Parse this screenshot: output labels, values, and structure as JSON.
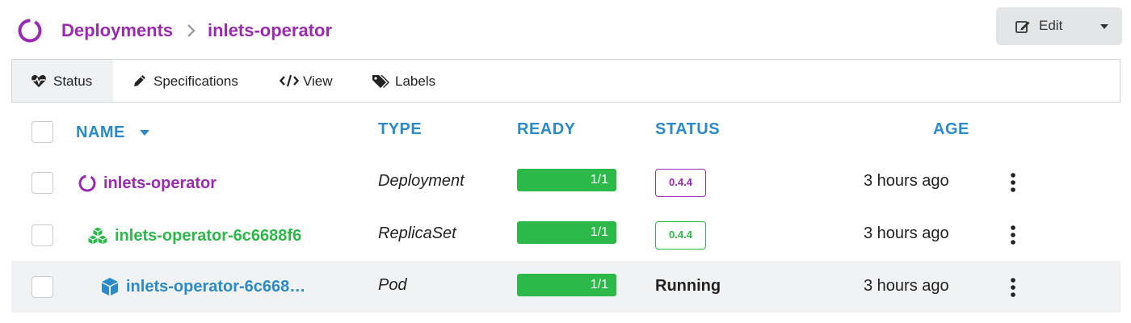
{
  "header": {
    "breadcrumb": [
      "Deployments",
      "inlets-operator"
    ],
    "edit_button": {
      "label": "Edit"
    }
  },
  "tabs": [
    {
      "label": "Status",
      "icon": "heartbeat-icon",
      "active": true
    },
    {
      "label": "Specifications",
      "icon": "pencil-icon",
      "active": false
    },
    {
      "label": "View",
      "icon": "code-icon",
      "active": false
    },
    {
      "label": "Labels",
      "icon": "tags-icon",
      "active": false
    }
  ],
  "table": {
    "columns": [
      "NAME",
      "TYPE",
      "READY",
      "STATUS",
      "AGE"
    ],
    "sort_column": "NAME",
    "rows": [
      {
        "name": "inlets-operator",
        "icon": "deployment-icon",
        "type": "Deployment",
        "ready": "1/1",
        "ready_fraction": 1.0,
        "status": "0.4.4",
        "status_kind": "badge",
        "age": "3 hours ago"
      },
      {
        "name": "inlets-operator-6c6688f6",
        "icon": "replicaset-icon",
        "type": "ReplicaSet",
        "ready": "1/1",
        "ready_fraction": 1.0,
        "status": "0.4.4",
        "status_kind": "badge",
        "age": "3 hours ago"
      },
      {
        "name": "inlets-operator-6c668…",
        "icon": "pod-icon",
        "type": "Pod",
        "ready": "1/1",
        "ready_fraction": 1.0,
        "status": "Running",
        "status_kind": "text",
        "age": "3 hours ago"
      }
    ]
  },
  "colors": {
    "deployment": "#9b2ab3",
    "replicaset": "#2db94a",
    "pod": "#2b8ac8",
    "header_text": "#2b8ac8",
    "ready_fill": "#2db94a"
  }
}
